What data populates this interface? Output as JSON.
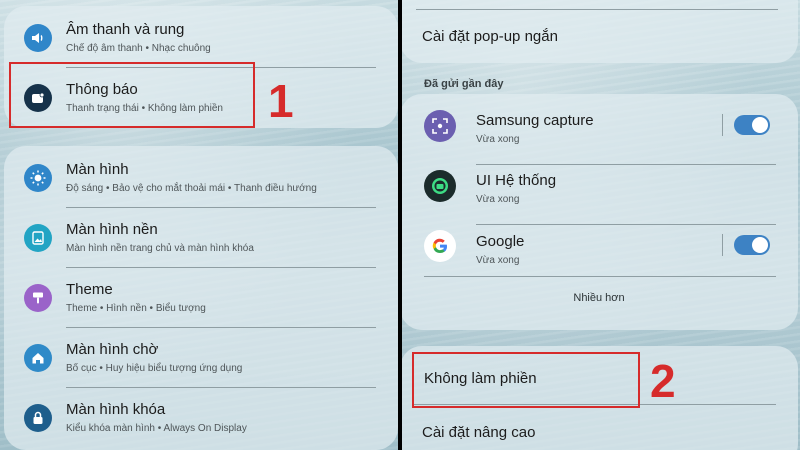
{
  "left_panel": {
    "card1": {
      "items": [
        {
          "title": "Âm thanh và rung",
          "subtitle": "Chế độ âm thanh  •  Nhạc chuông",
          "icon": "volume-icon"
        },
        {
          "title": "Thông báo",
          "subtitle": "Thanh trạng thái  •  Không làm phiền",
          "icon": "notification-icon"
        }
      ]
    },
    "card2": {
      "items": [
        {
          "title": "Màn hình",
          "subtitle": "Độ sáng  •  Bảo vệ cho mắt thoải mái  •  Thanh điều hướng",
          "icon": "brightness-icon"
        },
        {
          "title": "Màn hình nền",
          "subtitle": "Màn hình nền trang chủ và màn hình khóa",
          "icon": "wallpaper-icon"
        },
        {
          "title": "Theme",
          "subtitle": "Theme  •  Hình nền  •  Biểu tượng",
          "icon": "paint-brush-icon"
        },
        {
          "title": "Màn hình chờ",
          "subtitle": "Bố cục  •  Huy hiệu biểu tượng ứng dụng",
          "icon": "home-icon"
        },
        {
          "title": "Màn hình khóa",
          "subtitle": "Kiểu khóa màn hình  •  Always On Display",
          "icon": "lock-icon"
        }
      ]
    },
    "step_label": "1"
  },
  "right_panel": {
    "popup_setting": "Cài đặt pop-up ngắn",
    "recent_section_label": "Đã gửi gần đây",
    "recent_apps": [
      {
        "name": "Samsung capture",
        "time": "Vừa xong",
        "icon": "samsung-capture-icon",
        "toggle": true
      },
      {
        "name": "UI Hệ thống",
        "time": "Vừa xong",
        "icon": "android-system-icon",
        "toggle": false
      },
      {
        "name": "Google",
        "time": "Vừa xong",
        "icon": "google-icon",
        "toggle": true
      }
    ],
    "more_label": "Nhiều hơn",
    "dnd_label": "Không làm phiền",
    "advanced_label": "Cài đặt nâng cao",
    "step_label": "2"
  },
  "colors": {
    "highlight": "#d62b2b",
    "toggle_on": "#3d82c4",
    "volume_icon_bg": "#2f86c9",
    "notification_icon_bg": "#16324a",
    "display_icon_bg": "#2f86c9",
    "wallpaper_icon_bg": "#22a4c4",
    "theme_icon_bg": "#9a63c9",
    "home_icon_bg": "#2f8ac8",
    "lock_icon_bg": "#1e5e8c"
  }
}
